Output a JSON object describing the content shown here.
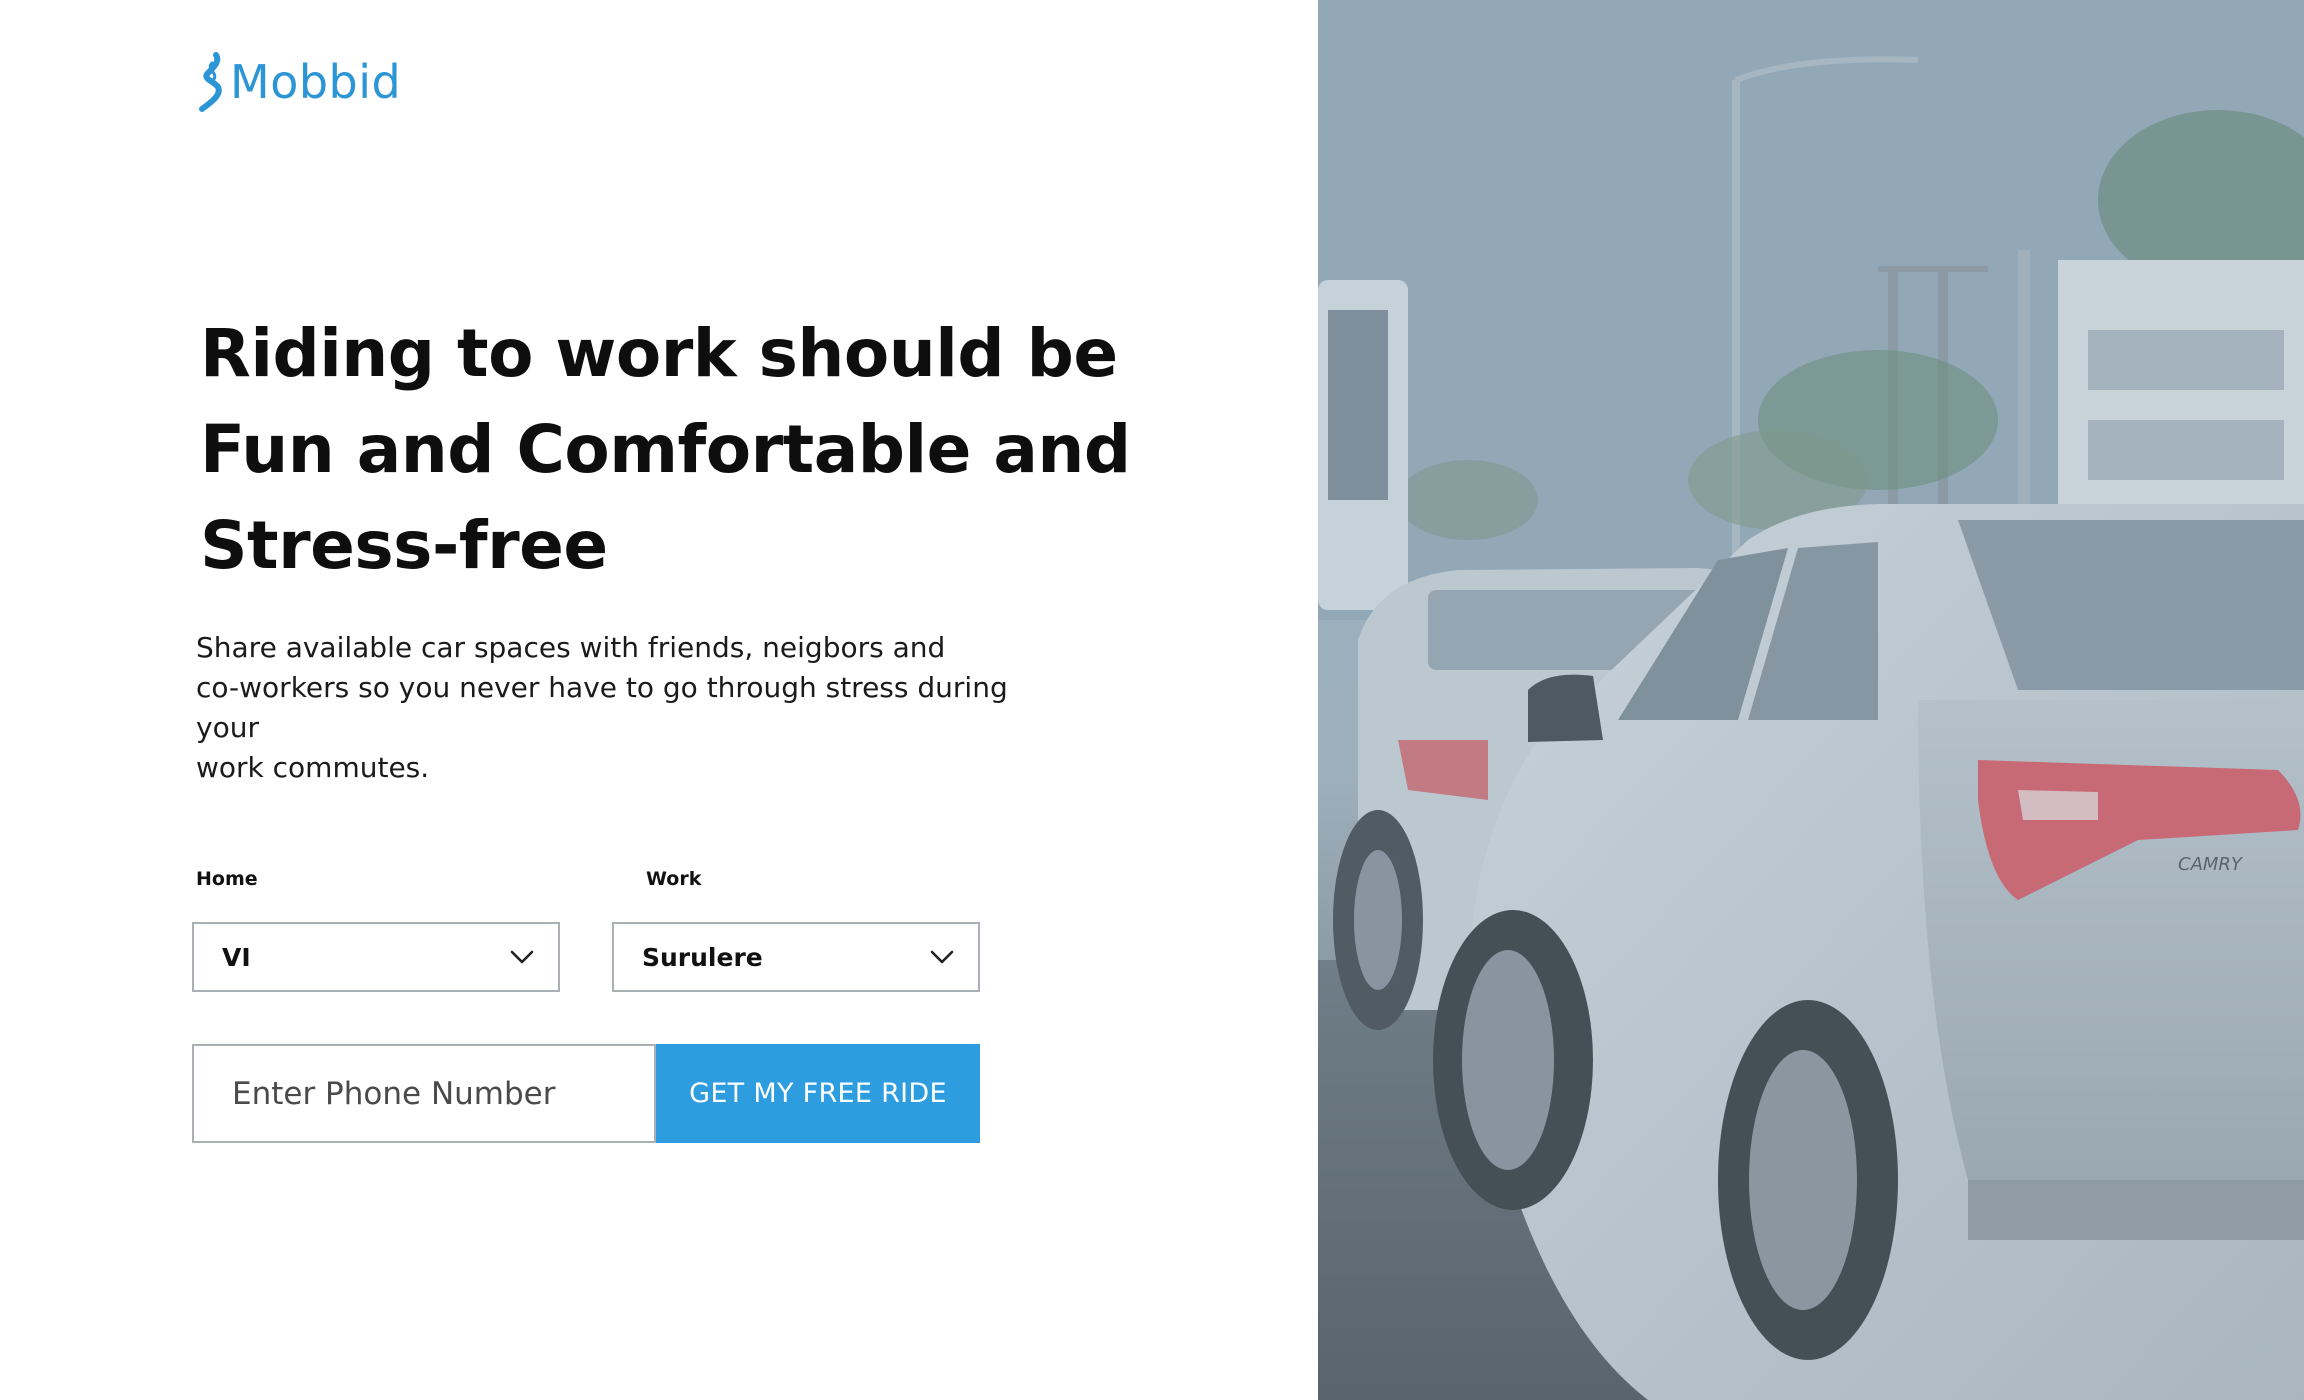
{
  "brand": {
    "name": "Mobbid",
    "color": "#2b95d6"
  },
  "hero": {
    "headline_line1": "Riding to work should be",
    "headline_line2": "Fun and Comfortable and",
    "headline_line3": "Stress-free",
    "subtext_line1": "Share available car spaces with friends, neigbors and",
    "subtext_line2": "co-workers so you never have to go through stress during your",
    "subtext_line3": "work commutes."
  },
  "form": {
    "home": {
      "label": "Home",
      "value": "VI"
    },
    "work": {
      "label": "Work",
      "value": "Surulere"
    },
    "phone": {
      "placeholder": "Enter Phone Number",
      "value": ""
    },
    "cta_label": "GET MY FREE RIDE",
    "cta_color": "#2d9de0"
  },
  "photo": {
    "subject": "traffic-with-cars",
    "car_badge": "CAMRY"
  }
}
